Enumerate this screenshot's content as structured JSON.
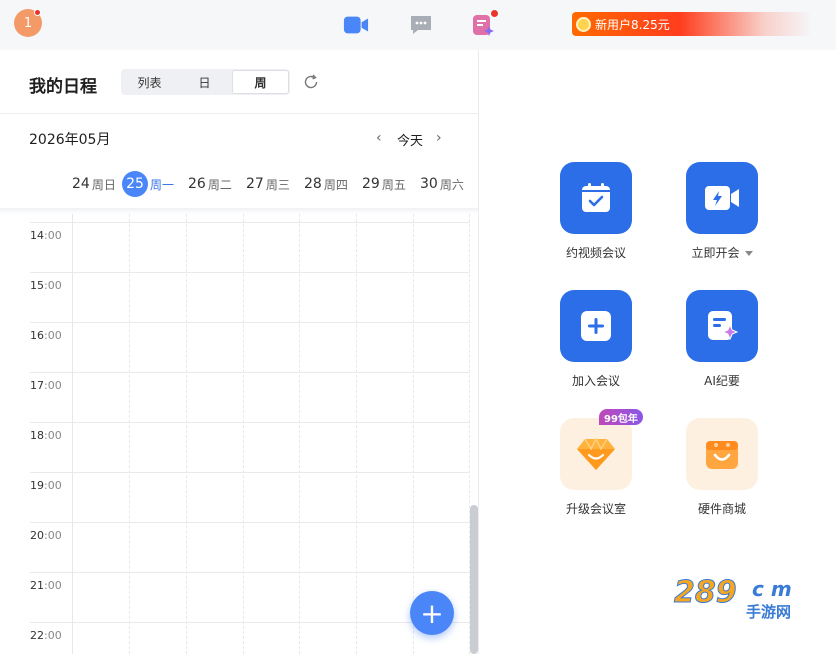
{
  "topbar": {
    "avatar_text": "1",
    "promo_text": "新用户8.25元"
  },
  "icons": {
    "video": "video-camera-icon",
    "chat": "chat-bubble-icon",
    "notes": "ai-notes-icon",
    "refresh": "refresh-icon"
  },
  "header": {
    "title": "我的日程",
    "view_tabs": [
      "列表",
      "日",
      "周"
    ],
    "active_tab": "周"
  },
  "calendar": {
    "month": "2026年05月",
    "today_label": "今天",
    "prev": "‹",
    "next": "›",
    "days": [
      {
        "num": "24",
        "wk": "周日"
      },
      {
        "num": "25",
        "wk": "周一"
      },
      {
        "num": "26",
        "wk": "周二"
      },
      {
        "num": "27",
        "wk": "周三"
      },
      {
        "num": "28",
        "wk": "周四"
      },
      {
        "num": "29",
        "wk": "周五"
      },
      {
        "num": "30",
        "wk": "周六"
      }
    ],
    "selected_day": "25",
    "hours": [
      "14",
      "15",
      "16",
      "17",
      "18",
      "19",
      "20",
      "21",
      "22"
    ],
    "minute_suffix": ":00"
  },
  "fab_label": "+",
  "actions": {
    "schedule": "约视频会议",
    "start_now": "立即开会",
    "join": "加入会议",
    "ai_notes": "AI纪要",
    "upgrade": "升级会议室",
    "upgrade_badge": "99包年",
    "store": "硬件商城"
  },
  "watermark": {
    "brand": "289",
    "suffix": "c m",
    "sub": "手游网"
  },
  "colors": {
    "accent": "#2b6ee8",
    "selected_day": "#4a86f7",
    "promo": "#ff5a1f",
    "badge_dot": "#e8342b"
  }
}
